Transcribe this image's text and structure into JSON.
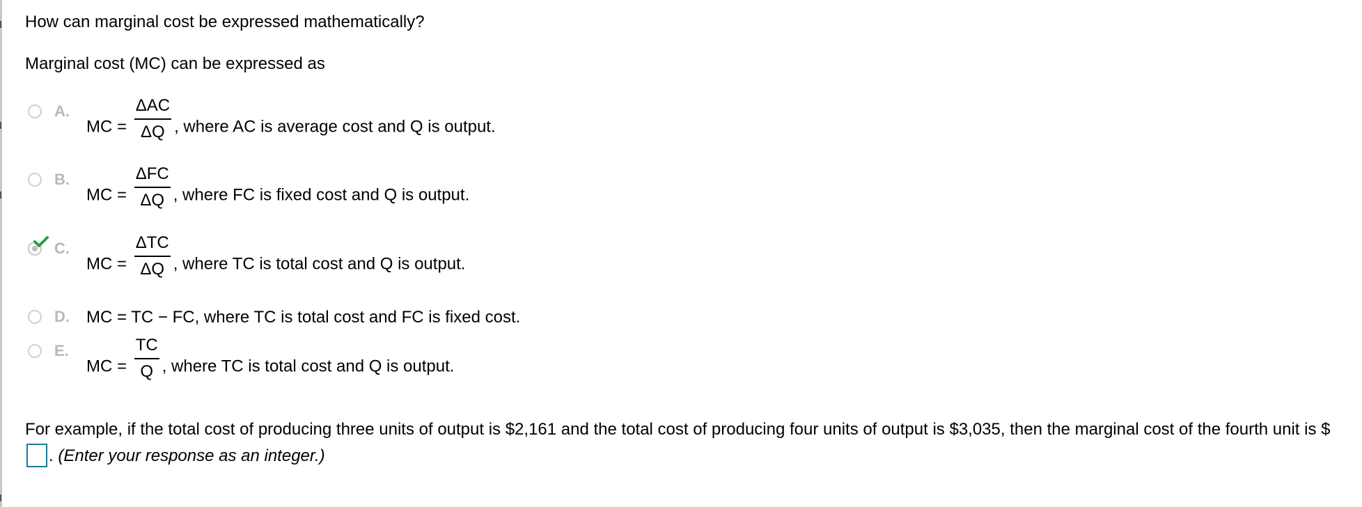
{
  "question": "How can marginal cost be expressed mathematically?",
  "intro": "Marginal cost (MC) can be expressed as",
  "options": [
    {
      "letter": "A.",
      "lhs": "MC =",
      "numerator": "ΔAC",
      "denominator": "ΔQ",
      "text": ", where AC is average cost and Q is output.",
      "selected": false
    },
    {
      "letter": "B.",
      "lhs": "MC =",
      "numerator": "ΔFC",
      "denominator": "ΔQ",
      "text": ", where FC is fixed cost and Q is output.",
      "selected": false
    },
    {
      "letter": "C.",
      "lhs": "MC =",
      "numerator": "ΔTC",
      "denominator": "ΔQ",
      "text": ", where TC is total cost and Q is output.",
      "selected": true,
      "correct": true
    },
    {
      "letter": "D.",
      "text": "MC = TC − FC, where TC is total cost and FC is fixed cost.",
      "selected": false
    },
    {
      "letter": "E.",
      "lhs": "MC =",
      "numerator": "TC",
      "denominator": "Q",
      "text": ", where TC is total cost and Q is output.",
      "selected": false
    }
  ],
  "example": {
    "text_before": "For example, if the total cost of producing three units of output is $2,161 and the total cost of producing four units of output is $3,035, then the marginal cost of the fourth unit is $",
    "answer_value": "",
    "text_after": ".",
    "hint": "(Enter your response as an integer.)"
  },
  "colors": {
    "correct_check": "#2e9e3a",
    "input_border": "#1a7a9b",
    "letter_gray": "#b8b8b8"
  }
}
